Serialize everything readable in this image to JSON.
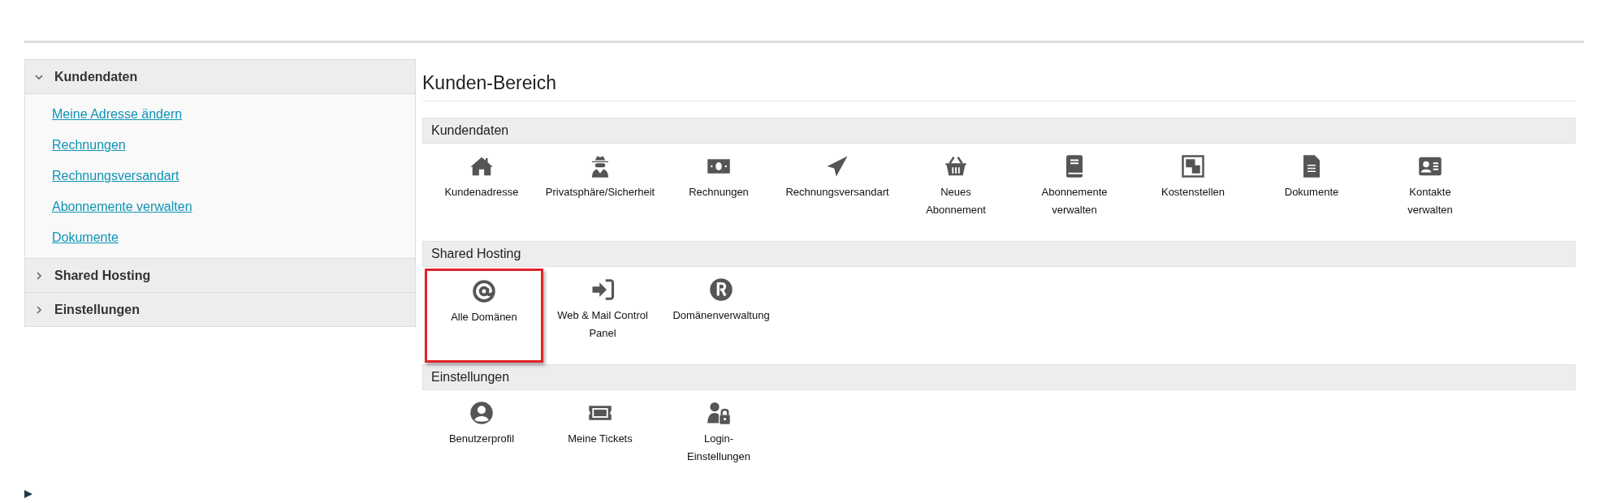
{
  "sidebar": {
    "sections": [
      {
        "label": "Kundendaten",
        "expanded": true,
        "items": [
          "Meine Adresse ändern",
          "Rechnungen",
          "Rechnungsversandart",
          "Abonnemente verwalten",
          "Dokumente"
        ]
      },
      {
        "label": "Shared Hosting",
        "expanded": false
      },
      {
        "label": "Einstellungen",
        "expanded": false
      }
    ]
  },
  "main": {
    "title": "Kunden-Bereich",
    "sections": [
      {
        "heading": "Kundendaten",
        "tiles": [
          {
            "label": "Kundenadresse",
            "highlighted": false
          },
          {
            "label": "Privatsphäre/Sicherheit",
            "highlighted": false
          },
          {
            "label": "Rechnungen",
            "highlighted": false
          },
          {
            "label": "Rechnungsversandart",
            "highlighted": false
          },
          {
            "label": "Neues\nAbonnement",
            "highlighted": false
          },
          {
            "label": "Abonnemente\nverwalten",
            "highlighted": false
          },
          {
            "label": "Kostenstellen",
            "highlighted": false
          },
          {
            "label": "Dokumente",
            "highlighted": false
          },
          {
            "label": "Kontakte\nverwalten",
            "highlighted": false
          }
        ]
      },
      {
        "heading": "Shared Hosting",
        "tiles": [
          {
            "label": "Alle Domänen",
            "highlighted": true
          },
          {
            "label": "Web & Mail Control\nPanel",
            "highlighted": false
          },
          {
            "label": "Domänenverwaltung",
            "highlighted": false
          }
        ]
      },
      {
        "heading": "Einstellungen",
        "tiles": [
          {
            "label": "Benutzerprofil",
            "highlighted": false
          },
          {
            "label": "Meine Tickets",
            "highlighted": false
          },
          {
            "label": "Login-\nEinstellungen",
            "highlighted": false
          }
        ]
      }
    ]
  }
}
